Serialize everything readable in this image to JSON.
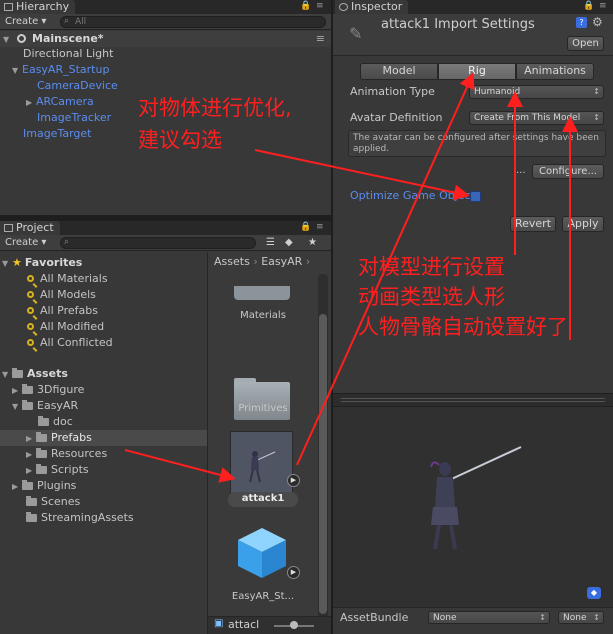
{
  "hierarchy": {
    "tab_label": "Hierarchy",
    "create_label": "Create",
    "search_placeholder": "All",
    "scene_name": "Mainscene*",
    "items": [
      {
        "label": "Directional Light",
        "level": 1
      },
      {
        "label": "EasyAR_Startup",
        "level": 1
      },
      {
        "label": "CameraDevice",
        "level": 2
      },
      {
        "label": "ARCamera",
        "level": 2
      },
      {
        "label": "ImageTracker",
        "level": 2
      },
      {
        "label": "ImageTarget",
        "level": 0
      }
    ]
  },
  "project": {
    "tab_label": "Project",
    "create_label": "Create",
    "favorites_label": "Favorites",
    "favorites": [
      "All Materials",
      "All Models",
      "All Prefabs",
      "All Modified",
      "All Conflicted"
    ],
    "assets_label": "Assets",
    "assets_tree": [
      {
        "label": "3Dfigure",
        "level": 1
      },
      {
        "label": "EasyAR",
        "level": 1
      },
      {
        "label": "doc",
        "level": 2
      },
      {
        "label": "Prefabs",
        "level": 2
      },
      {
        "label": "Resources",
        "level": 2
      },
      {
        "label": "Scripts",
        "level": 2
      },
      {
        "label": "Plugins",
        "level": 1
      },
      {
        "label": "Scenes",
        "level": 1
      },
      {
        "label": "StreamingAssets",
        "level": 1
      }
    ],
    "breadcrumb": [
      "Assets",
      "EasyAR"
    ],
    "grid_items": [
      "Materials",
      "Primitives",
      "attack1",
      "EasyAR_St..."
    ],
    "bottom_search_value": "attacl"
  },
  "inspector": {
    "tab_label": "Inspector",
    "title": "attack1 Import Settings",
    "open_label": "Open",
    "tabs": [
      "Model",
      "Rig",
      "Animations"
    ],
    "active_tab": "Rig",
    "animation_type_label": "Animation Type",
    "animation_type_value": "Humanoid",
    "avatar_definition_label": "Avatar Definition",
    "avatar_definition_value": "Create From This Model",
    "info_text": "The avatar can be configured after settings have been applied.",
    "ellipsis": "...",
    "configure_label": "Configure...",
    "optimize_label": "Optimize Game Objects",
    "revert_label": "Revert",
    "apply_label": "Apply",
    "assetbundle_label": "AssetBundle",
    "assetbundle_value": "None",
    "assetbundle_variant": "None"
  },
  "annotations": {
    "note1_line1": "对物体进行优化,",
    "note1_line2": "建议勾选",
    "note2_line1": "对模型进行设置",
    "note2_line2": "动画类型选人形",
    "note2_line3": "人物骨骼自动设置好了"
  },
  "colors": {
    "annotation_red": "#ff1f1f",
    "link_blue": "#5a8df0",
    "panel_bg": "#383838"
  }
}
